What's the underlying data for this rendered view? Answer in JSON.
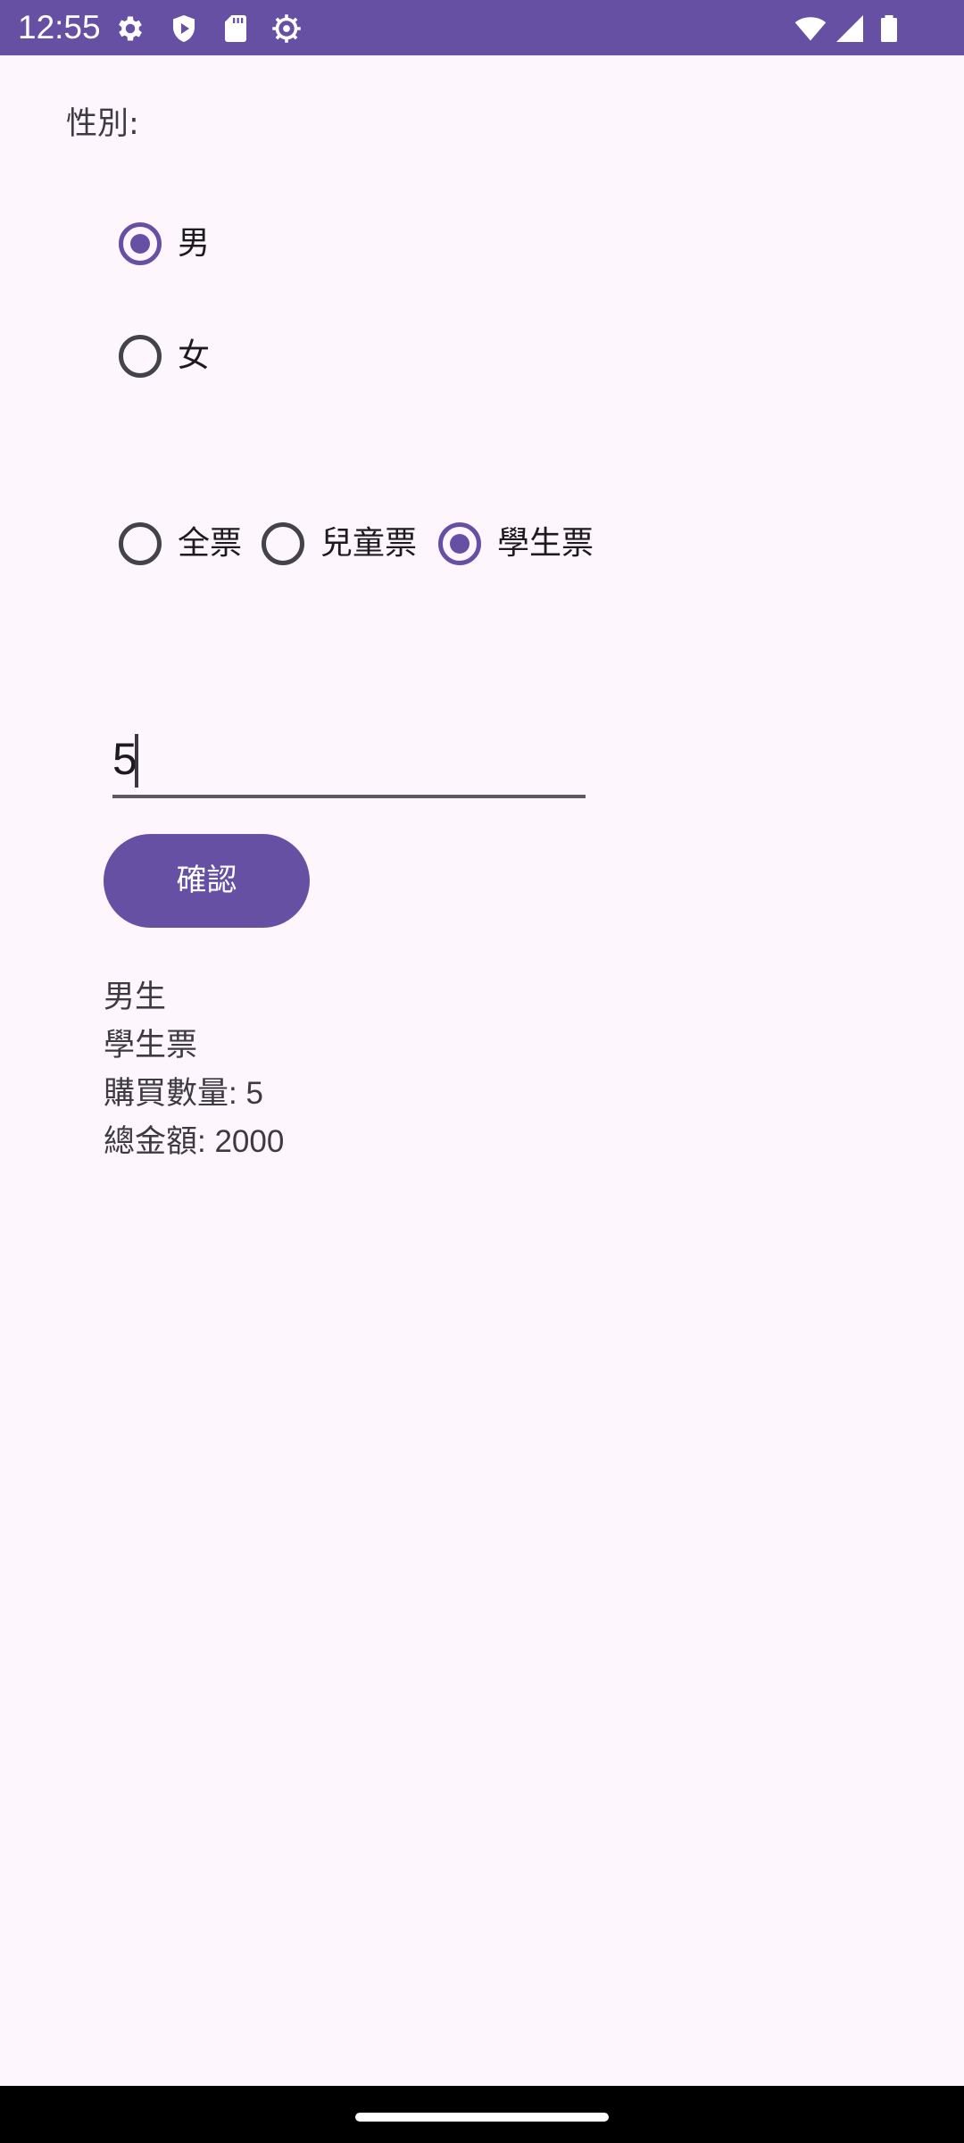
{
  "status_bar": {
    "time": "12:55",
    "left_icons": [
      "gear-icon",
      "play-protect-icon",
      "sd-card-icon",
      "settings-cog-icon"
    ],
    "right_icons": [
      "wifi-icon",
      "signal-icon",
      "battery-icon"
    ],
    "background": "#6650a4"
  },
  "form": {
    "gender_label": "性別:",
    "gender_options": [
      {
        "label": "男",
        "checked": true
      },
      {
        "label": "女",
        "checked": false
      }
    ],
    "ticket_options": [
      {
        "label": "全票",
        "checked": false
      },
      {
        "label": "兒童票",
        "checked": false
      },
      {
        "label": "學生票",
        "checked": true
      }
    ],
    "quantity_value": "5",
    "confirm_label": "確認"
  },
  "result": {
    "gender": "男生",
    "ticket": "學生票",
    "quantity_line": "購買數量: 5",
    "total_line": "總金額: 2000"
  },
  "colors": {
    "accent": "#6650a4",
    "background": "#fdf7fd",
    "nav_bar": "#000000"
  }
}
